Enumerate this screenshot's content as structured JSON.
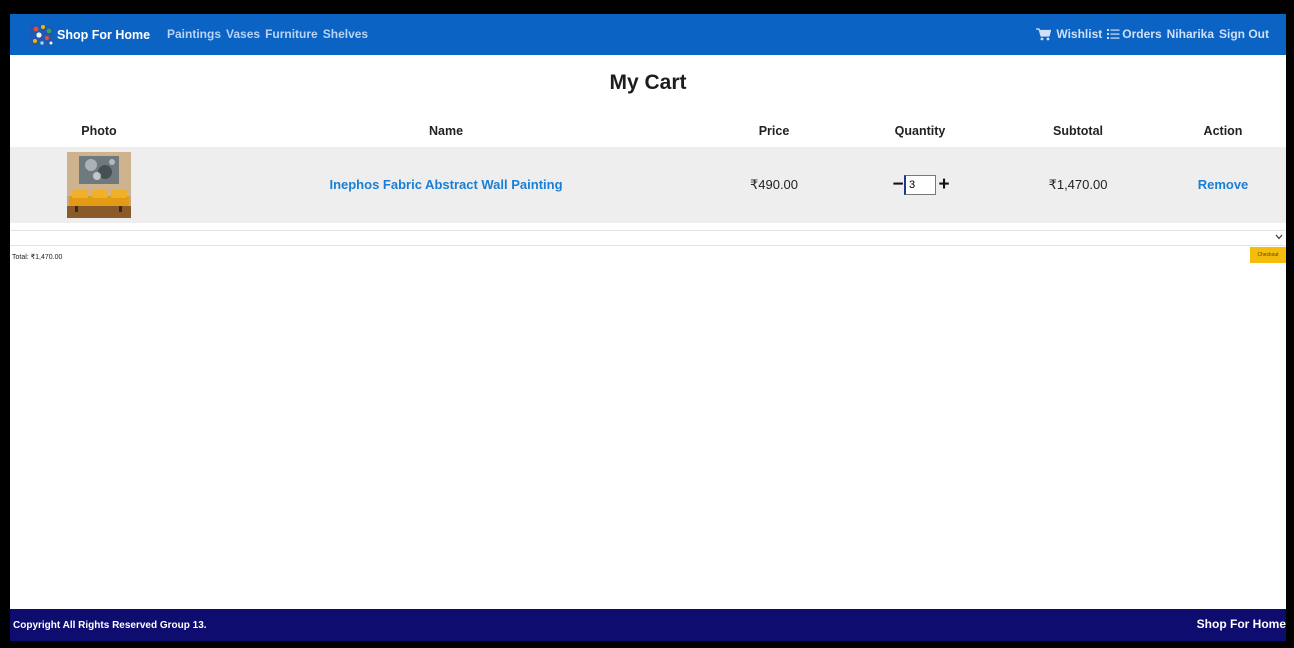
{
  "navbar": {
    "brand": "Shop For Home",
    "categories": [
      "Paintings",
      "Vases",
      "Furniture",
      "Shelves"
    ],
    "wishlist": "Wishlist",
    "orders": "Orders",
    "user": "Niharika",
    "sign_out": "Sign Out",
    "bar_color": "#0b63c4"
  },
  "page_title": "My Cart",
  "table": {
    "headers": [
      "Photo",
      "Name",
      "Price",
      "Quantity",
      "Subtotal",
      "Action"
    ],
    "rows": [
      {
        "name": "Inephos Fabric Abstract Wall Painting",
        "price": "₹490.00",
        "quantity": "3",
        "subtotal": "₹1,470.00",
        "action": "Remove",
        "minus": "−",
        "plus": "+"
      }
    ]
  },
  "summary": {
    "total": "Total: ₹1,470.00",
    "checkout": "Checkout"
  },
  "footer": {
    "copyright": "Copyright All Rights Reserved Group 13.",
    "brand": "Shop For Home",
    "bar_color": "#0e0c6e"
  }
}
